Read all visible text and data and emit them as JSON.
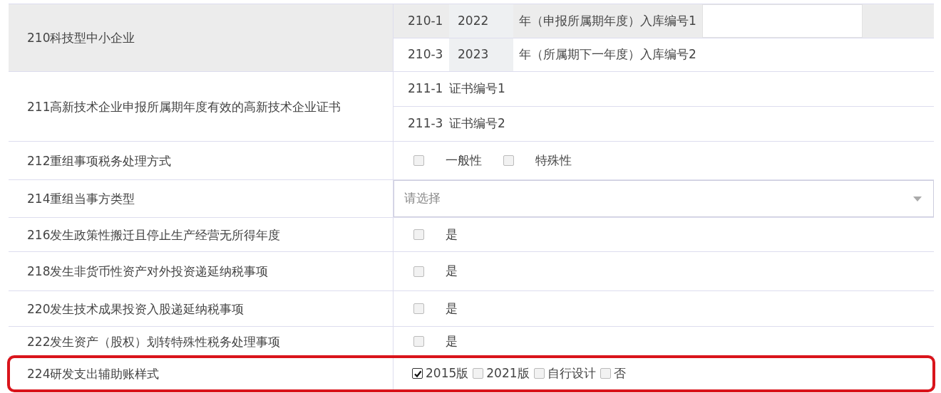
{
  "rows": [
    {
      "label": "210科技型中小企业",
      "kind": "sub_inputs",
      "highlighted": true,
      "subs": [
        {
          "code": "210-1",
          "year": "2022",
          "text": "年（申报所属期年度）入库编号1",
          "highlighted": true,
          "has_field": true
        },
        {
          "code": "210-3",
          "year": "2023",
          "text": "年（所属期下一年度）入库编号2",
          "highlighted": false,
          "has_field": false
        }
      ]
    },
    {
      "label": "211高新技术企业申报所属期年度有效的高新技术企业证书",
      "kind": "sub_inputs",
      "highlighted": false,
      "subs": [
        {
          "code": "211-1",
          "text": "证书编号1",
          "highlighted": false,
          "has_field": false
        },
        {
          "code": "211-3",
          "text": "证书编号2",
          "highlighted": false,
          "has_field": false
        }
      ]
    },
    {
      "label": "212重组事项税务处理方式",
      "kind": "checkboxes",
      "highlighted": false,
      "options": [
        {
          "label": "一般性",
          "checked": false
        },
        {
          "label": "特殊性",
          "checked": false
        }
      ]
    },
    {
      "label": "214重组当事方类型",
      "kind": "select",
      "highlighted": false,
      "placeholder": "请选择"
    },
    {
      "label": "216发生政策性搬迁且停止生产经营无所得年度",
      "kind": "checkboxes",
      "highlighted": false,
      "options": [
        {
          "label": "是",
          "checked": false
        }
      ]
    },
    {
      "label": "218发生非货币性资产对外投资递延纳税事项",
      "kind": "checkboxes",
      "highlighted": false,
      "options": [
        {
          "label": "是",
          "checked": false
        }
      ]
    },
    {
      "label": "220发生技术成果投资入股递延纳税事项",
      "kind": "checkboxes",
      "highlighted": false,
      "options": [
        {
          "label": "是",
          "checked": false
        }
      ]
    },
    {
      "label": "222发生资产（股权）划转特殊性税务处理事项",
      "kind": "checkboxes",
      "highlighted": false,
      "options": [
        {
          "label": "是",
          "checked": false
        }
      ]
    },
    {
      "label": "224研发支出辅助账样式",
      "kind": "compact_checkboxes",
      "highlighted": false,
      "outlined": true,
      "options": [
        {
          "label": "2015版",
          "checked": true
        },
        {
          "label": "2021版",
          "checked": false
        },
        {
          "label": "自行设计",
          "checked": false
        },
        {
          "label": "否",
          "checked": false
        }
      ]
    }
  ]
}
